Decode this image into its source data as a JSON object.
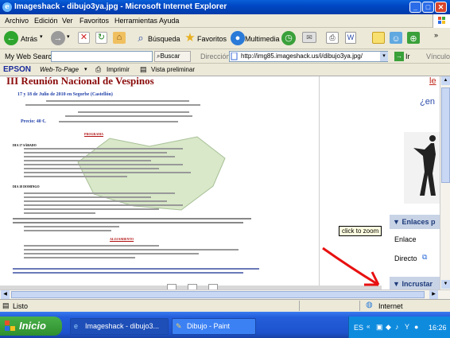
{
  "window": {
    "title": "Imageshack - dibujo3ya.jpg - Microsoft Internet Explorer"
  },
  "menu": [
    "Archivo",
    "Edición",
    "Ver",
    "Favoritos",
    "Herramientas",
    "Ayuda"
  ],
  "toolbar": {
    "back_label": "Atrás",
    "search_label": "Búsqueda",
    "favorites_label": "Favoritos",
    "media_label": "Multimedia"
  },
  "searchbar": {
    "myweb_label": "My Web Search",
    "search_value": "",
    "buscar_label": "Buscar",
    "direccion_label": "Dirección",
    "url": "http://img85.imageshack.us/i/dibujo3ya.jpg/",
    "ir_label": "Ir",
    "vinculos_label": "Vínculos"
  },
  "epson": {
    "brand": "EPSON",
    "webtopage": "Web-To-Page",
    "print_label": "Imprimir",
    "preview_label": "Vista preliminar"
  },
  "document": {
    "heading": "III Reunión Nacional de Vespinos",
    "date_line": "17 y 18 de Julio de 2010 en Segorbe (Castellón)",
    "precio_line": "Precio: 40 €.",
    "programa": "PROGRAMA",
    "day1": "DIA 17 SÁBADO",
    "day2": "DIA 18 DOMINGO",
    "alojamiento": "ALOJAMIENTO"
  },
  "tooltip": "click to zoom",
  "sidebar": {
    "top_link": "le",
    "question": "¿en",
    "enlaces_head": "Enlaces p",
    "enlace": "Enlace",
    "directo": "Directo",
    "incrustar_head": "Incrustar"
  },
  "status": {
    "left": "Listo",
    "zone": "Internet"
  },
  "taskbar": {
    "start": "Inicio",
    "items": [
      "Imageshack - dibujo3...",
      "Dibujo - Paint"
    ],
    "lang": "ES",
    "clock": "16:26"
  },
  "colors": {
    "titlebar": "#0047c4",
    "arrow": "#e81010",
    "taskbar": "#245edb",
    "start": "#2e8f2e"
  }
}
